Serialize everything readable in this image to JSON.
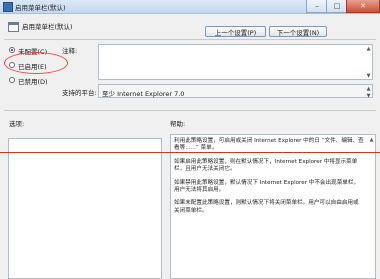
{
  "window": {
    "title": "启用菜单栏(默认)",
    "controls": {
      "minimize": "–",
      "maximize": "□",
      "close": "✕"
    }
  },
  "header": {
    "setting_name": "启用菜单栏(默认)"
  },
  "nav": {
    "previous": "上一个设置(P)",
    "next": "下一个设置(N)"
  },
  "options": {
    "not_configured": "未配置(C)",
    "enabled": "已启用(E)",
    "disabled": "已禁用(D)"
  },
  "labels": {
    "comment": "注释:",
    "supported_on": "支持的平台:",
    "options": "选项:",
    "help": "帮助:"
  },
  "supported_on_value": "至少 Internet Explorer 7.0",
  "help": {
    "paragraphs": [
      "利用此策略设置，可启用或关闭 Internet Explorer 中的日 “文件、编辑、查看等......” 菜单。",
      "如果启用此策略设置，则在默认情况下，Internet Explorer 中将显示菜单栏，且用户无法关闭它。",
      "如果禁用此策略设置，默认情况下 Internet Explorer 中不会出现菜单栏，用户无法将其启用。",
      "如果未配置此策略设置，则默认情况下将关闭菜单栏。用户可以自由启用或关闭菜单栏。"
    ]
  },
  "colors": {
    "annotation": "#e44a4a"
  }
}
